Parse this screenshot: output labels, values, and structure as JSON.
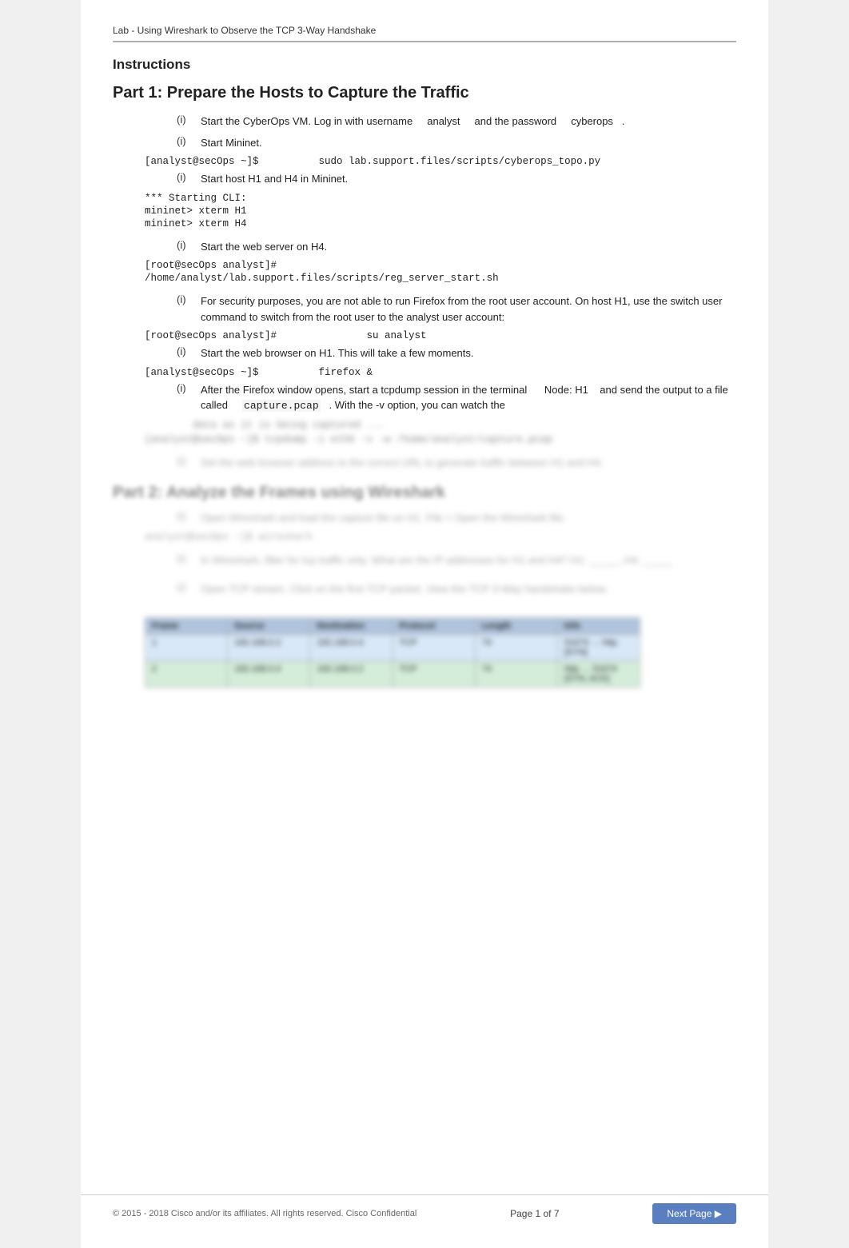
{
  "page": {
    "top_bar_title": "Lab - Using Wireshark to Observe the TCP 3-Way Handshake",
    "instructions_heading": "Instructions",
    "part1_title": "Part 1:   Prepare the Hosts to Capture the Traffic",
    "steps": [
      {
        "id": "1a",
        "marker": "(i)",
        "text_prefix": "Start the CyberOps VM. Log in with username",
        "username": "analyst",
        "text_mid": "and the password",
        "password": "cyberops",
        "text_suffix": "."
      },
      {
        "id": "1b",
        "marker": "(i)",
        "text": "Start Mininet."
      }
    ],
    "cmd1": "[analyst@secOps ~]$          sudo lab.support.files/scripts/cyberops_topo.py",
    "step1c": {
      "marker": "(i)",
      "text": "Start host H1 and H4 in Mininet."
    },
    "cli_lines": [
      "*** Starting CLI:",
      "mininet>      xterm H1",
      "mininet>      xterm H4"
    ],
    "step1d": {
      "marker": "(i)",
      "text": "Start the web server on H4."
    },
    "cmd2_lines": [
      "[root@secOps analyst]#",
      "/home/analyst/lab.support.files/scripts/reg_server_start.sh"
    ],
    "step1e": {
      "marker": "(i)",
      "text": "For security purposes, you are not able to run Firefox from the root user account. On host H1, use the switch user command to switch from the root user to the analyst user account:"
    },
    "cmd3": "[root@secOps analyst]#               su analyst",
    "step1f": {
      "marker": "(i)",
      "text": "Start the web browser on H1. This will take a few moments."
    },
    "cmd4": "[analyst@secOps ~]$          firefox &",
    "step1g": {
      "marker": "(i)",
      "text_prefix": "After the Firefox window opens, start a tcpdump session in the terminal",
      "node_label": "Node: H1",
      "text_mid": "and send the output to a file called",
      "file_label": "capture.pcap",
      "text_suffix": ". With the -v option, you can watch the"
    },
    "blurred_lines": [
      "data as ...",
      "[analyst@secOps ~]$   tcpdump -i eth0 -v -w /home/analyst/capture.pcap",
      "",
      "(i)  Set the web browser address to the correct URL to generate traffic between H1 and H4."
    ],
    "part2_title": "Part 2:   Analyze the Frames using Wireshark",
    "part2_steps": [
      {
        "marker": "(i)",
        "text": "Open Wireshark and load the capture file on H1. File > Open the Wireshark file."
      }
    ],
    "part2_cmd": "analyst@secOps ~]$        wireshark",
    "part2_step2": {
      "marker": "(i)",
      "text": "In Wireshark, filter for tcp traffic only. What are the IP addresses for H1 and H4? H1: _____, H4: _____"
    },
    "part2_step3": {
      "marker": "(i)",
      "text": "Open TCP stream. Click on the first TCP packet."
    },
    "table_header": [
      "Frame",
      "Source",
      "Destination",
      "Protocol",
      "Length",
      "Info"
    ],
    "table_row1": [
      "1",
      "192.168.0.2",
      "192.168.0.4",
      "TCP",
      "74",
      "51674 → http [SYN]"
    ],
    "table_row2": [
      "2",
      "192.168.0.4",
      "192.168.0.2",
      "TCP",
      "74",
      "http → 51674 [SYN,ACK]"
    ],
    "bottom": {
      "left_text": "© 2015 - 2018 Cisco and/or its affiliates. All rights reserved. Cisco Confidential",
      "center_text": "Page 1 of 7",
      "button_label": "Next Page ▶"
    }
  }
}
